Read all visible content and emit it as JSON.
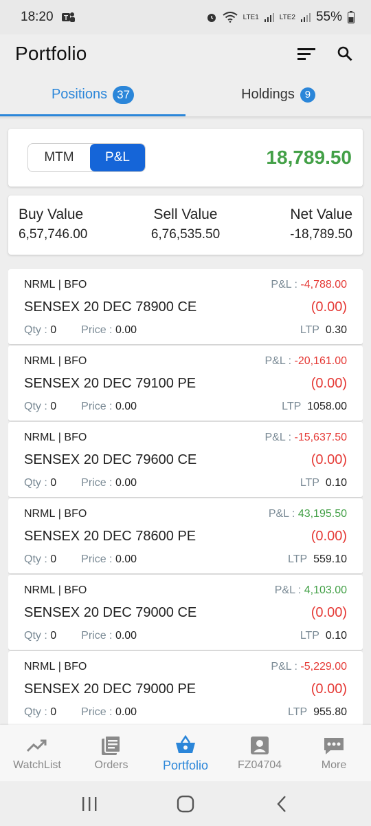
{
  "status_bar": {
    "time": "18:20",
    "sim1": "LTE1",
    "sim2": "LTE2",
    "battery": "55%"
  },
  "header": {
    "title": "Portfolio",
    "sort_icon": "sort-icon",
    "search_icon": "search-icon"
  },
  "tabs": [
    {
      "label": "Positions",
      "count": "37",
      "active": true
    },
    {
      "label": "Holdings",
      "count": "9",
      "active": false
    }
  ],
  "summary": {
    "toggle": [
      "MTM",
      "P&L"
    ],
    "selected": "P&L",
    "value": "18,789.50",
    "value_color": "#43a047"
  },
  "values": {
    "buy_label": "Buy Value",
    "buy_value": "6,57,746.00",
    "sell_label": "Sell Value",
    "sell_value": "6,76,535.50",
    "net_label": "Net Value",
    "net_value": "-18,789.50"
  },
  "labels": {
    "pnl": "P&L :",
    "qty": "Qty :",
    "price": "Price :",
    "ltp": "LTP"
  },
  "positions": [
    {
      "product": "NRML",
      "exchange": "BFO",
      "symbol": "SENSEX 20 DEC 78900 CE",
      "pnl": "-4,788.00",
      "pnl_sign": "neg",
      "change": "(0.00)",
      "qty": "0",
      "price": "0.00",
      "ltp": "0.30"
    },
    {
      "product": "NRML",
      "exchange": "BFO",
      "symbol": "SENSEX 20 DEC 79100 PE",
      "pnl": "-20,161.00",
      "pnl_sign": "neg",
      "change": "(0.00)",
      "qty": "0",
      "price": "0.00",
      "ltp": "1058.00"
    },
    {
      "product": "NRML",
      "exchange": "BFO",
      "symbol": "SENSEX 20 DEC 79600 CE",
      "pnl": "-15,637.50",
      "pnl_sign": "neg",
      "change": "(0.00)",
      "qty": "0",
      "price": "0.00",
      "ltp": "0.10"
    },
    {
      "product": "NRML",
      "exchange": "BFO",
      "symbol": "SENSEX 20 DEC 78600 PE",
      "pnl": "43,195.50",
      "pnl_sign": "pos",
      "change": "(0.00)",
      "qty": "0",
      "price": "0.00",
      "ltp": "559.10"
    },
    {
      "product": "NRML",
      "exchange": "BFO",
      "symbol": "SENSEX 20 DEC 79000 CE",
      "pnl": "4,103.00",
      "pnl_sign": "pos",
      "change": "(0.00)",
      "qty": "0",
      "price": "0.00",
      "ltp": "0.10"
    },
    {
      "product": "NRML",
      "exchange": "BFO",
      "symbol": "SENSEX 20 DEC 79000 PE",
      "pnl": "-5,229.00",
      "pnl_sign": "neg",
      "change": "(0.00)",
      "qty": "0",
      "price": "0.00",
      "ltp": "955.80"
    }
  ],
  "bottom_nav": [
    {
      "label": "WatchList",
      "icon": "trending-up-icon",
      "active": false
    },
    {
      "label": "Orders",
      "icon": "orders-list-icon",
      "active": false
    },
    {
      "label": "Portfolio",
      "icon": "basket-icon",
      "active": true
    },
    {
      "label": "FZ04704",
      "icon": "account-icon",
      "active": false
    },
    {
      "label": "More",
      "icon": "more-dots-icon",
      "active": false
    }
  ],
  "colors": {
    "accent": "#2b86d9",
    "toggle_active": "#1565d8",
    "negative": "#e53935",
    "positive": "#43a047"
  }
}
